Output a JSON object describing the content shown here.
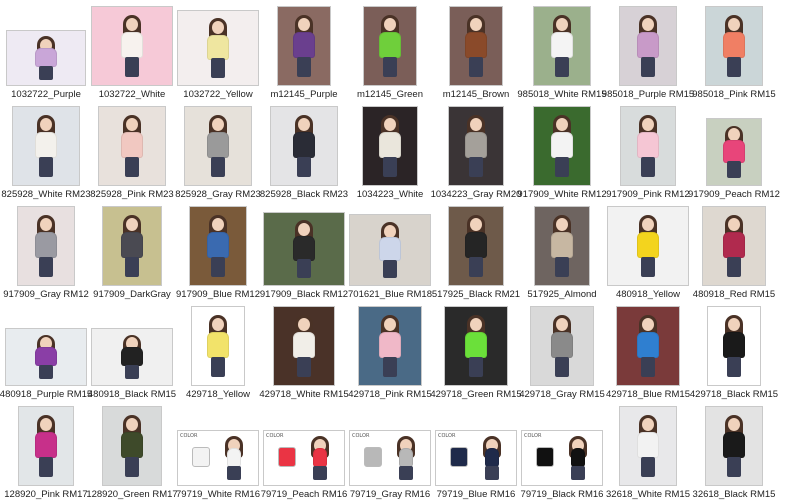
{
  "rows": [
    [
      {
        "label": "1032722_Purple",
        "color": "#c9a6d8",
        "bg": "#eeeaf3",
        "w": 78,
        "h": 54
      },
      {
        "label": "1032722_White",
        "color": "#f7f2ee",
        "bg": "#f6c9d7",
        "w": 80,
        "h": 78
      },
      {
        "label": "1032722_Yellow",
        "color": "#efe6a0",
        "bg": "#f3eeee",
        "w": 80,
        "h": 74
      },
      {
        "label": "m12145_Purple",
        "color": "#6a3f8e",
        "bg": "#8a6a62",
        "w": 52,
        "h": 78
      },
      {
        "label": "m12145_Green",
        "color": "#6fcf3b",
        "bg": "#7b5e58",
        "w": 52,
        "h": 78
      },
      {
        "label": "m12145_Brown",
        "color": "#8a4a2a",
        "bg": "#7a5e58",
        "w": 52,
        "h": 78
      },
      {
        "label": "985018_White RM15",
        "color": "#f4f4f4",
        "bg": "#9bb08c",
        "w": 56,
        "h": 78
      },
      {
        "label": "985018_Purple RM15",
        "color": "#c89ac8",
        "bg": "#d7d1d6",
        "w": 56,
        "h": 78
      },
      {
        "label": "985018_Pink RM15",
        "color": "#f07f64",
        "bg": "#cbd6d8",
        "w": 56,
        "h": 78
      }
    ],
    [
      {
        "label": "825928_White RM23",
        "color": "#f3f1ec",
        "bg": "#dfe3e8",
        "w": 66,
        "h": 78
      },
      {
        "label": "825928_Pink RM23",
        "color": "#f1c8c1",
        "bg": "#e8e1dc",
        "w": 66,
        "h": 78
      },
      {
        "label": "825928_Gray RM23",
        "color": "#9a9a9a",
        "bg": "#e6e1da",
        "w": 66,
        "h": 78
      },
      {
        "label": "825928_Black RM23",
        "color": "#2a2c36",
        "bg": "#e4e4e6",
        "w": 66,
        "h": 78
      },
      {
        "label": "1034223_White",
        "color": "#eae6dc",
        "bg": "#2b2426",
        "w": 54,
        "h": 78
      },
      {
        "label": "1034223_Gray RM20",
        "color": "#a4a09a",
        "bg": "#3a3436",
        "w": 54,
        "h": 78
      },
      {
        "label": "917909_White RM12",
        "color": "#f3f3f3",
        "bg": "#3a6a2e",
        "w": 56,
        "h": 78
      },
      {
        "label": "917909_Pink RM12",
        "color": "#f5c6d4",
        "bg": "#d8dcdc",
        "w": 54,
        "h": 78
      },
      {
        "label": "917909_Peach RM12",
        "color": "#e8457a",
        "bg": "#c8d0c0",
        "w": 54,
        "h": 66
      }
    ],
    [
      {
        "label": "917909_Gray RM12",
        "color": "#9a9aa2",
        "bg": "#e8e0e0",
        "w": 56,
        "h": 78
      },
      {
        "label": "917909_DarkGray",
        "color": "#4a4a52",
        "bg": "#c7c090",
        "w": 58,
        "h": 78
      },
      {
        "label": "917909_Blue RM12",
        "color": "#3a6ab0",
        "bg": "#7a5a3a",
        "w": 56,
        "h": 78
      },
      {
        "label": "917909_Black RM12",
        "color": "#2a2a2a",
        "bg": "#5a6b4a",
        "w": 80,
        "h": 72
      },
      {
        "label": "701621_Blue RM18",
        "color": "#cdd6ea",
        "bg": "#d8d3cc",
        "w": 80,
        "h": 70
      },
      {
        "label": "517925_Black RM21",
        "color": "#252525",
        "bg": "#6e5a4a",
        "w": 54,
        "h": 78
      },
      {
        "label": "517925_Almond",
        "color": "#c7b7a2",
        "bg": "#6e6460",
        "w": 54,
        "h": 78
      },
      {
        "label": "480918_Yellow",
        "color": "#f3d41e",
        "bg": "#f2f2f2",
        "w": 80,
        "h": 78
      },
      {
        "label": "480918_Red RM15",
        "color": "#b02a4e",
        "bg": "#ded8d0",
        "w": 62,
        "h": 78
      }
    ],
    [
      {
        "label": "480918_Purple RM15",
        "color": "#8a3ea6",
        "bg": "#e8ecef",
        "w": 80,
        "h": 56
      },
      {
        "label": "480918_Black RM15",
        "color": "#222222",
        "bg": "#f0f0f0",
        "w": 80,
        "h": 56
      },
      {
        "label": "429718_Yellow",
        "color": "#f2e36a",
        "bg": "#ffffff",
        "w": 52,
        "h": 78
      },
      {
        "label": "429718_White RM15",
        "color": "#f1eee8",
        "bg": "#4a3228",
        "w": 60,
        "h": 78
      },
      {
        "label": "429718_Pink RM15",
        "color": "#f0b8c8",
        "bg": "#4a6a86",
        "w": 62,
        "h": 78
      },
      {
        "label": "429718_Green RM15",
        "color": "#6be03a",
        "bg": "#2a2a2a",
        "w": 62,
        "h": 78
      },
      {
        "label": "429718_Gray RM15",
        "color": "#8a8a8a",
        "bg": "#d9d9d9",
        "w": 62,
        "h": 78
      },
      {
        "label": "429718_Blue RM15",
        "color": "#2f7fd0",
        "bg": "#7a3a3a",
        "w": 62,
        "h": 78
      },
      {
        "label": "429718_Black RM15",
        "color": "#1a1a1a",
        "bg": "#ffffff",
        "w": 52,
        "h": 78
      }
    ],
    [
      {
        "label": "128920_Pink RM17",
        "color": "#c7308a",
        "bg": "#e2e6e8",
        "w": 54,
        "h": 78
      },
      {
        "label": "128920_Green RM17",
        "color": "#3e4a2a",
        "bg": "#d8dada",
        "w": 58,
        "h": 78
      },
      {
        "label": "79719_White RM16",
        "color": "#f3f3f3",
        "bg": "#ffffff",
        "w": 80,
        "h": 54,
        "sheet": true
      },
      {
        "label": "79719_Peach RM16",
        "color": "#ea3444",
        "bg": "#ffffff",
        "w": 80,
        "h": 54,
        "sheet": true
      },
      {
        "label": "79719_Gray RM16",
        "color": "#b8b8b8",
        "bg": "#ffffff",
        "w": 80,
        "h": 54,
        "sheet": true
      },
      {
        "label": "79719_Blue RM16",
        "color": "#1f2a4a",
        "bg": "#ffffff",
        "w": 80,
        "h": 54,
        "sheet": true
      },
      {
        "label": "79719_Black RM16",
        "color": "#111111",
        "bg": "#ffffff",
        "w": 80,
        "h": 54,
        "sheet": true
      },
      {
        "label": "32618_White RM15",
        "color": "#f2f2f2",
        "bg": "#e8e8ea",
        "w": 56,
        "h": 78
      },
      {
        "label": "32618_Black RM15",
        "color": "#1a1a1a",
        "bg": "#e3e3e3",
        "w": 56,
        "h": 78
      }
    ]
  ],
  "sheet_header": "COLOR"
}
